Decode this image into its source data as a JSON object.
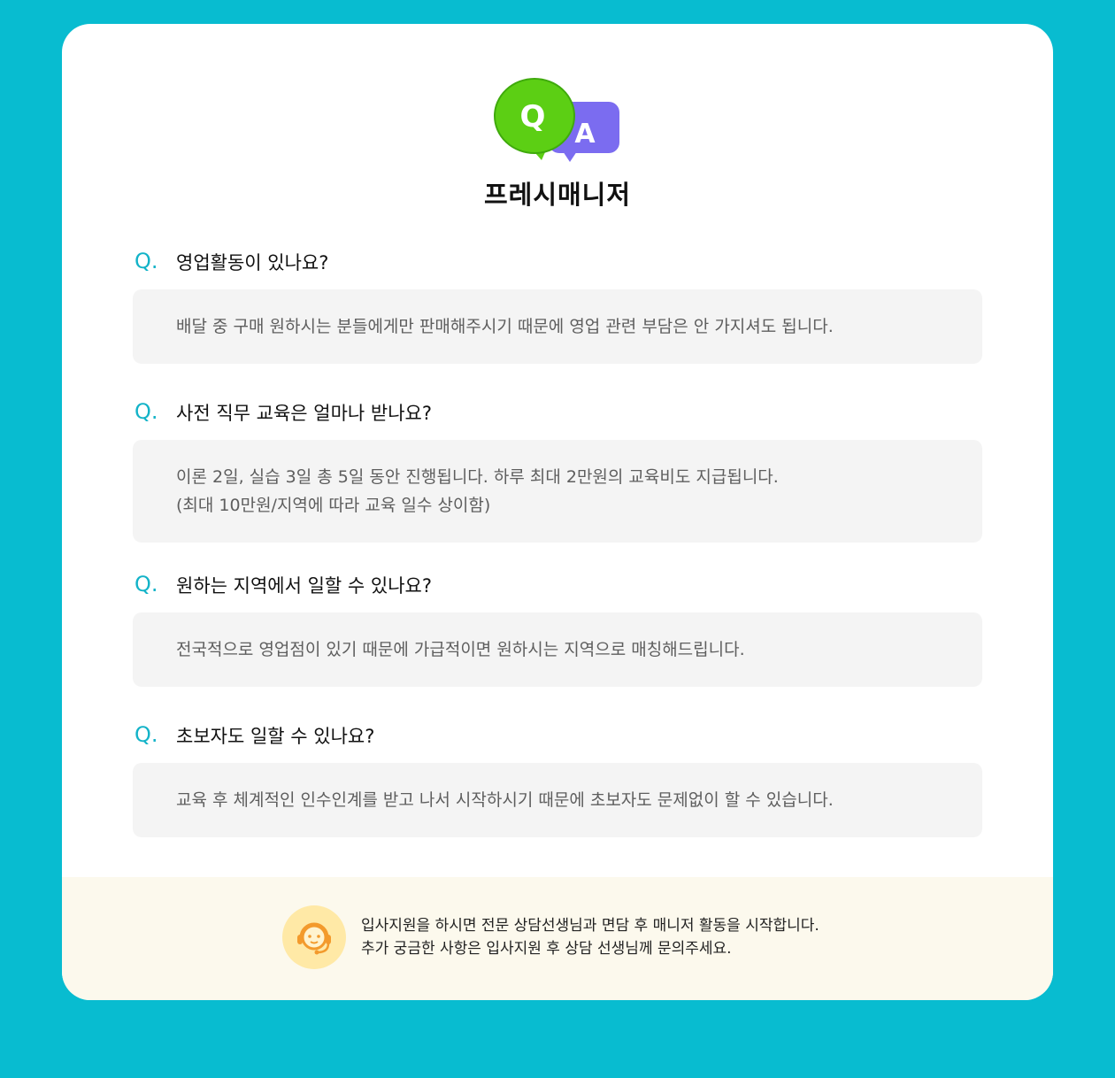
{
  "page": {
    "title": "프레시매니저"
  },
  "faq": [
    {
      "q_mark": "Q.",
      "question": "영업활동이 있나요?",
      "answer_lines": [
        "배달 중 구매 원하시는 분들에게만 판매해주시기 때문에 영업 관련 부담은 안 가지셔도 됩니다."
      ]
    },
    {
      "q_mark": "Q.",
      "question": "사전 직무 교육은 얼마나 받나요?",
      "answer_lines": [
        "이론 2일, 실습 3일 총 5일 동안 진행됩니다. 하루 최대 2만원의 교육비도 지급됩니다.",
        "(최대 10만원/지역에 따라 교육 일수 상이함)"
      ]
    },
    {
      "q_mark": "Q.",
      "question": "원하는 지역에서 일할 수 있나요?",
      "answer_lines": [
        "전국적으로 영업점이 있기 때문에 가급적이면 원하시는 지역으로 매칭해드립니다."
      ]
    },
    {
      "q_mark": "Q.",
      "question": "초보자도 일할 수 있나요?",
      "answer_lines": [
        "교육 후 체계적인 인수인계를 받고 나서 시작하시기 때문에 초보자도 문제없이 할 수 있습니다."
      ]
    }
  ],
  "footer": {
    "line1": "입사지원을 하시면 전문 상담선생님과 면담 후 매니저 활동을 시작합니다.",
    "line2": "추가 궁금한 사항은 입사지원 후 상담 선생님께 문의주세요."
  },
  "logo": {
    "q_letter": "Q",
    "a_letter": "A"
  },
  "colors": {
    "background": "#08bcd0",
    "accent": "#13b3c8",
    "q_bubble": "#5ccf14",
    "a_bubble": "#7b6cf0",
    "answer_bg": "#f4f4f4",
    "footer_bg": "#fcf9ed",
    "avatar_bg": "#ffe9a6"
  },
  "icons": {
    "logo": "qa-bubbles-icon",
    "avatar": "headset-agent-icon"
  }
}
